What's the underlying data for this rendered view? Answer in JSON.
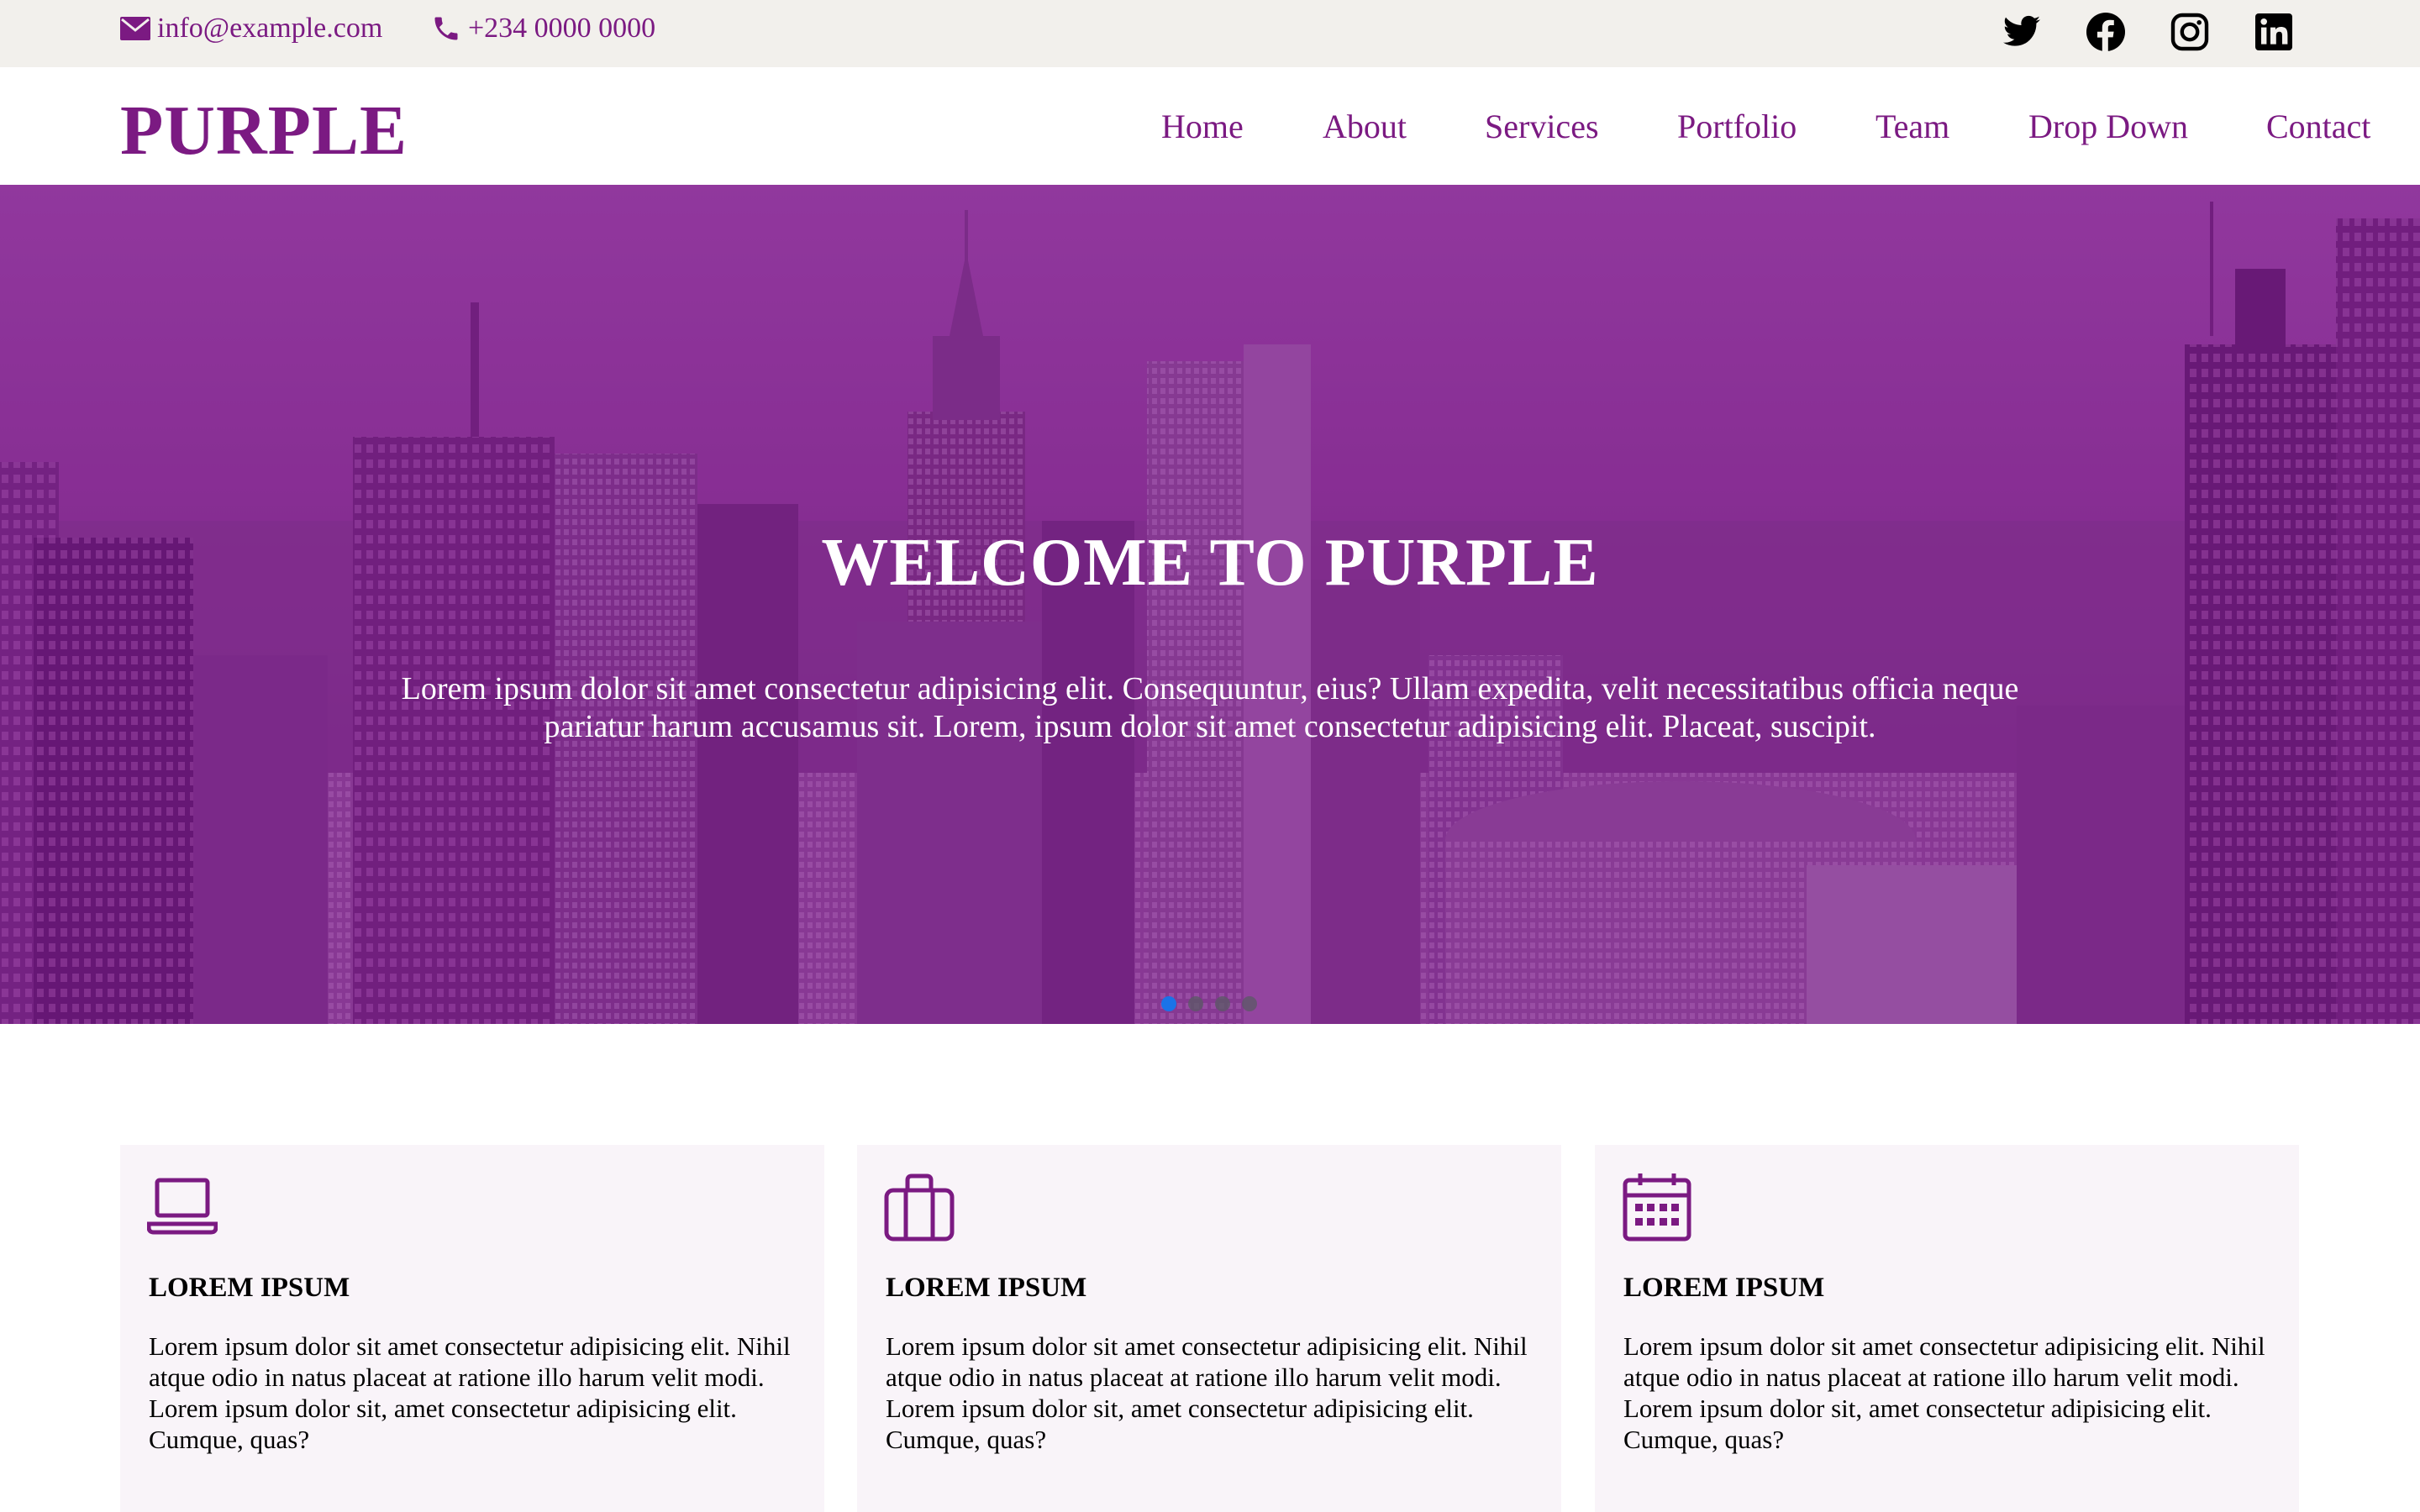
{
  "topbar": {
    "email": "info@example.com",
    "phone": "+234 0000 0000",
    "social": [
      "twitter-icon",
      "facebook-icon",
      "instagram-icon",
      "linkedin-icon"
    ]
  },
  "header": {
    "logo": "PURPLE",
    "nav": [
      "Home",
      "About",
      "Services",
      "Portfolio",
      "Team",
      "Drop Down",
      "Contact"
    ]
  },
  "hero": {
    "title": "WELCOME TO PURPLE",
    "text": "Lorem ipsum dolor sit amet consectetur adipisicing elit. Consequuntur, eius? Ullam expedita, velit necessitatibus officia neque pariatur harum accusamus sit. Lorem, ipsum dolor sit amet consectetur adipisicing elit. Placeat, suscipit.",
    "slides_total": 4,
    "active_slide": 1
  },
  "cards": [
    {
      "icon": "laptop-icon",
      "title": "LOREM IPSUM",
      "text": "Lorem ipsum dolor sit amet consectetur adipisicing elit. Nihil atque odio in natus placeat at ratione illo harum velit modi. Lorem ipsum dolor sit, amet consectetur adipisicing elit. Cumque, quas?"
    },
    {
      "icon": "briefcase-icon",
      "title": "LOREM IPSUM",
      "text": "Lorem ipsum dolor sit amet consectetur adipisicing elit. Nihil atque odio in natus placeat at ratione illo harum velit modi. Lorem ipsum dolor sit, amet consectetur adipisicing elit. Cumque, quas?"
    },
    {
      "icon": "calendar-icon",
      "title": "LOREM IPSUM",
      "text": "Lorem ipsum dolor sit amet consectetur adipisicing elit. Nihil atque odio in natus placeat at ratione illo harum velit modi. Lorem ipsum dolor sit, amet consectetur adipisicing elit. Cumque, quas?"
    }
  ],
  "colors": {
    "brand": "#7b1a82",
    "topbar_bg": "#f2f0ec",
    "card_bg": "#f9f4f9",
    "carousel_active": "#1a73e8"
  }
}
